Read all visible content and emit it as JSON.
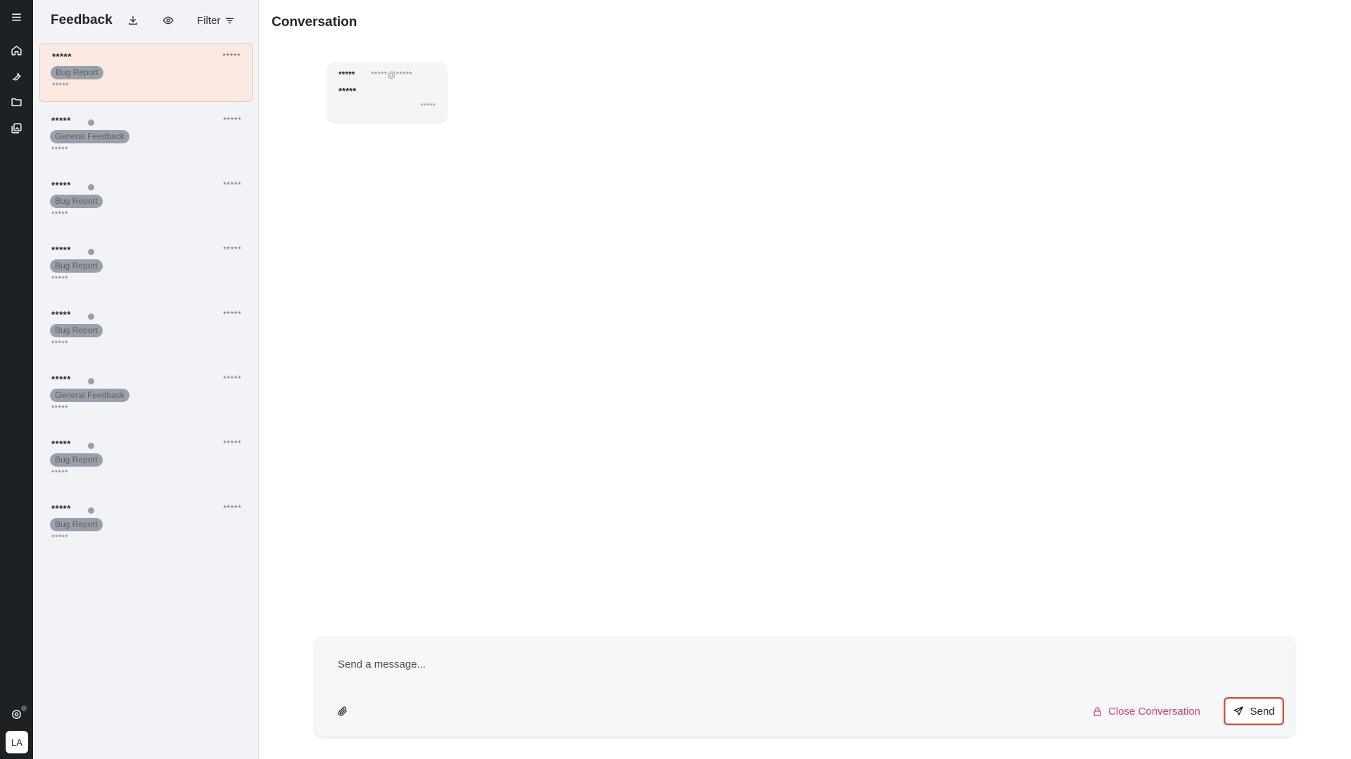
{
  "rail": {
    "icons": [
      "menu-icon",
      "home-icon",
      "wrench-icon",
      "folder-icon",
      "gallery-icon",
      "support-icon"
    ],
    "avatar": "LA"
  },
  "feedback": {
    "title": "Feedback",
    "filter_label": "Filter",
    "items": [
      {
        "name": "*****",
        "date": "*****",
        "tag": "Bug Report",
        "sub": "*****",
        "active": true,
        "unread": false
      },
      {
        "name": "*****",
        "date": "*****",
        "tag": "General Feedback",
        "sub": "*****",
        "active": false,
        "unread": true
      },
      {
        "name": "*****",
        "date": "*****",
        "tag": "Bug Report",
        "sub": "*****",
        "active": false,
        "unread": true
      },
      {
        "name": "*****",
        "date": "*****",
        "tag": "Bug Report",
        "sub": "*****",
        "active": false,
        "unread": true
      },
      {
        "name": "*****",
        "date": "*****",
        "tag": "Bug Report",
        "sub": "*****",
        "active": false,
        "unread": true
      },
      {
        "name": "*****",
        "date": "*****",
        "tag": "General Feedback",
        "sub": "*****",
        "active": false,
        "unread": true
      },
      {
        "name": "*****",
        "date": "*****",
        "tag": "Bug Report",
        "sub": "*****",
        "active": false,
        "unread": true
      },
      {
        "name": "*****",
        "date": "*****",
        "tag": "Bug Report",
        "sub": "*****",
        "active": false,
        "unread": true
      }
    ]
  },
  "conversation": {
    "title": "Conversation",
    "message": {
      "name": "*****",
      "email": "*****@*****",
      "text": "*****",
      "time": "*****"
    }
  },
  "composer": {
    "placeholder": "Send a message...",
    "close_label": "Close Conversation",
    "send_label": "Send"
  },
  "colors": {
    "rail_bg": "#1e2124",
    "list_bg": "#f1f3f7",
    "active_item_bg": "#fbe9e2",
    "tag_bg": "#9aa0aa",
    "danger": "#d63e72",
    "send_border": "#d64a54"
  }
}
